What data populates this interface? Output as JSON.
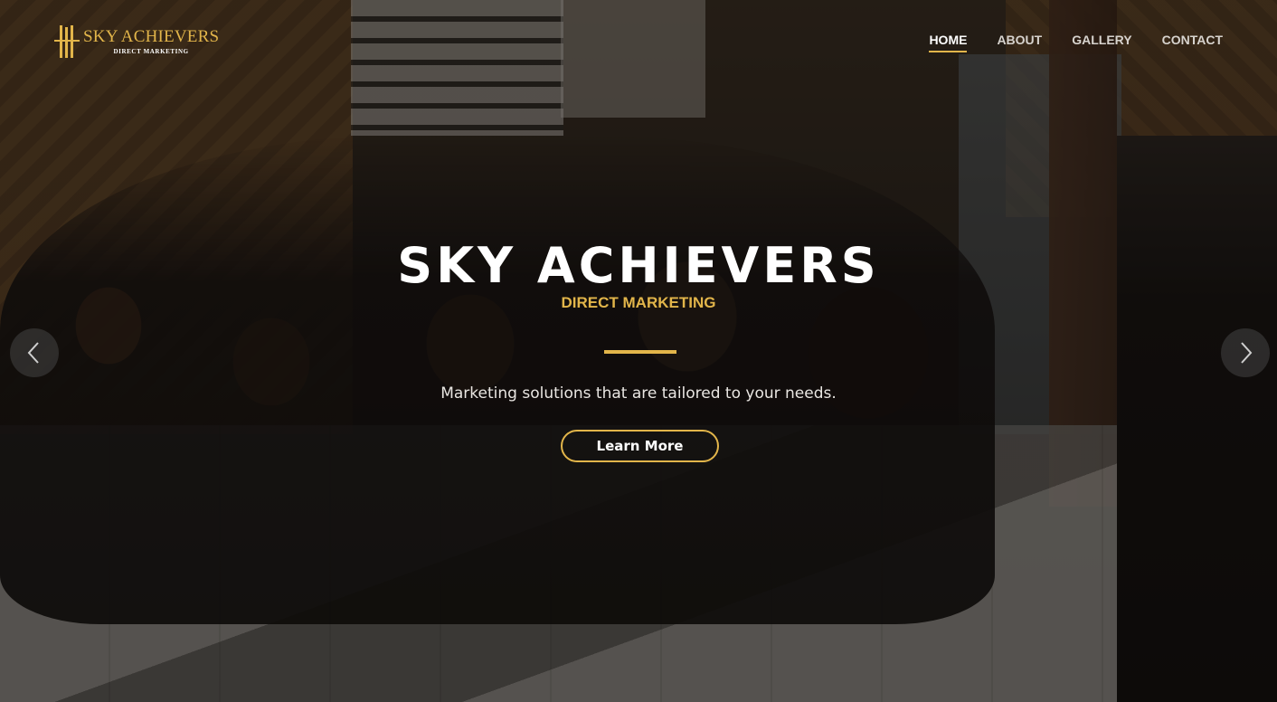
{
  "brand": {
    "title": "SKY ACHIEVERS",
    "subtitle": "DIRECT MARKETING",
    "accent_color": "#e2b54a"
  },
  "nav": {
    "items": [
      {
        "label": "HOME",
        "active": true
      },
      {
        "label": "ABOUT",
        "active": false
      },
      {
        "label": "GALLERY",
        "active": false
      },
      {
        "label": "CONTACT",
        "active": false
      }
    ]
  },
  "hero": {
    "title": "SKY ACHIEVERS",
    "subtitle": "DIRECT MARKETING",
    "tagline": "Marketing solutions that are tailored to your needs.",
    "button_label": "Learn More"
  },
  "carousel": {
    "prev_icon": "chevron-left-icon",
    "next_icon": "chevron-right-icon"
  }
}
